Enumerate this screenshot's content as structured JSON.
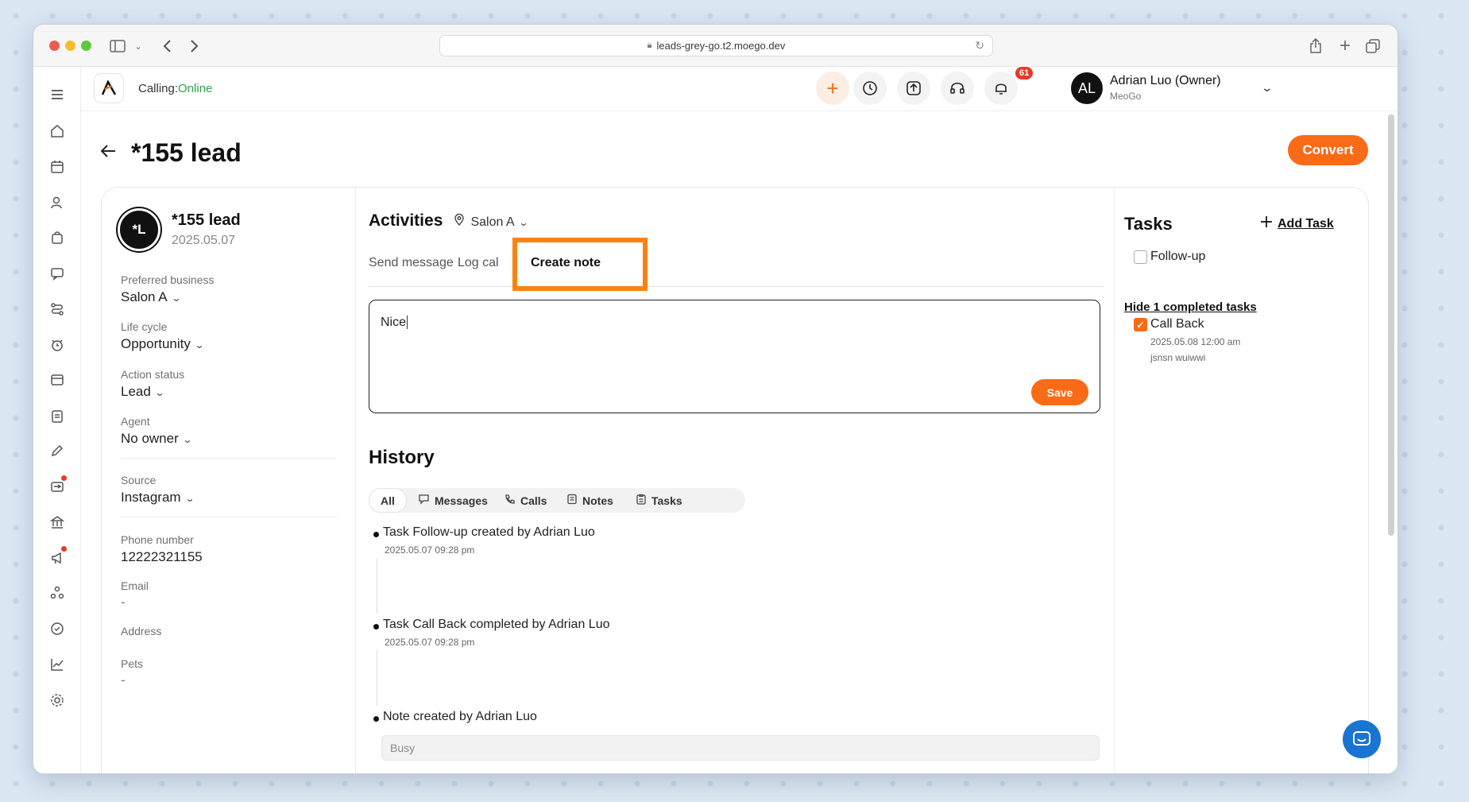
{
  "browser": {
    "url": "leads-grey-go.t2.moego.dev"
  },
  "topbar": {
    "calling_label": "Calling:",
    "calling_status": "Online",
    "notification_count": "61",
    "user": {
      "initials": "AL",
      "name": "Adrian Luo (Owner)",
      "org": "MeoGo"
    }
  },
  "page": {
    "title": "*155 lead",
    "convert_label": "Convert"
  },
  "lead": {
    "initials": "*L",
    "name": "*155 lead",
    "date": "2025.05.07",
    "fields": {
      "preferred_business": {
        "label": "Preferred business",
        "value": "Salon A"
      },
      "life_cycle": {
        "label": "Life cycle",
        "value": "Opportunity"
      },
      "action_status": {
        "label": "Action status",
        "value": "Lead"
      },
      "agent": {
        "label": "Agent",
        "value": "No owner"
      },
      "source": {
        "label": "Source",
        "value": "Instagram"
      },
      "phone": {
        "label": "Phone number",
        "value": "12222321155"
      },
      "email": {
        "label": "Email",
        "value": "-"
      },
      "address": {
        "label": "Address",
        "value": ""
      },
      "pets": {
        "label": "Pets",
        "value": "-"
      }
    }
  },
  "activities": {
    "title": "Activities",
    "location": "Salon A",
    "tabs": [
      "Send message",
      "Log cal",
      "Create note"
    ],
    "note_value": "Nice",
    "save_label": "Save"
  },
  "history": {
    "title": "History",
    "filters": [
      "All",
      "Messages",
      "Calls",
      "Notes",
      "Tasks"
    ],
    "items": [
      {
        "text": "Task Follow-up created by Adrian Luo",
        "time": "2025.05.07 09:28 pm"
      },
      {
        "text": "Task Call Back completed by Adrian Luo",
        "time": "2025.05.07 09:28 pm"
      },
      {
        "text": "Note created by Adrian Luo",
        "note": "Busy"
      }
    ]
  },
  "tasks": {
    "title": "Tasks",
    "add_label": "Add Task",
    "open": [
      {
        "label": "Follow-up",
        "checked": false
      }
    ],
    "hide_completed_label": "Hide 1 completed tasks",
    "completed": [
      {
        "label": "Call Back",
        "checked": true,
        "due": "2025.05.08 12:00 am",
        "note": "jsnsn wuiwwi"
      }
    ]
  },
  "colors": {
    "accent": "#f96b16",
    "highlight": "#f98312",
    "online": "#2aa24a"
  }
}
